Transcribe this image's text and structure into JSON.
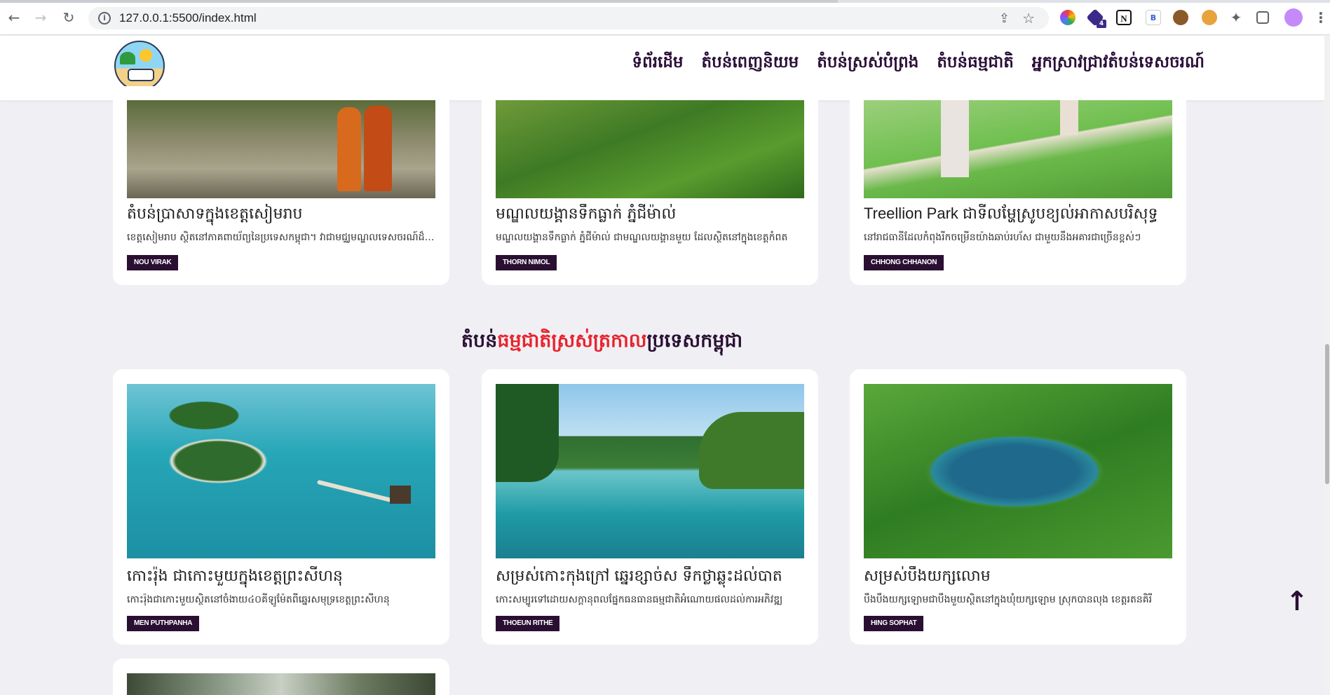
{
  "browser": {
    "url": "127.0.0.1:5500/index.html",
    "extensions": [
      "color-wheel-extension-icon",
      "vpn-extension-icon",
      "notion-extension-icon",
      "bold-extension-icon",
      "cookie-extension-icon",
      "cookie-alt-extension-icon",
      "puzzle-extensions-icon",
      "sidebar-icon",
      "profile-avatar"
    ],
    "vpn_badge": "4"
  },
  "nav": {
    "items": [
      "ទំព័រដើម",
      "តំបន់ពេញនិយម",
      "តំបន់ស្រស់បំព្រង",
      "តំបន់ធម្មជាតិ",
      "អ្នកស្រាវជ្រាវតំបន់ទេសចរណ៍"
    ]
  },
  "section": {
    "title_pre": "តំបន់",
    "title_accent": "ធម្មជាតិស្រស់ត្រកាល",
    "title_post": "ប្រទេសកម្ពុជា"
  },
  "top_cards": [
    {
      "title": "តំបន់ប្រាសាទក្នុងខេត្តសៀមរាប",
      "desc": "ខេត្តសៀមរាប ស្ថិតនៅភាគពាយ័ព្យនៃប្រទេសកម្ពុជា។ វាជាមជ្ឈមណ្ឌលទេសចរណ៍ដ៏សំខាន់",
      "author": "NOU VIRAK"
    },
    {
      "title": "មណ្ឌលយង្គានទឹកធ្លាក់ ភ្នំជីម៉ាល់",
      "desc": "មណ្ឌលយង្គានទឹកធ្លាក់ ភ្នំជីម៉ាល់ ជាមណ្ឌលយង្គានមួយ ដែលស្ថិតនៅក្នុងខេត្តកំពត",
      "author": "THORN NIMOL"
    },
    {
      "title": "Treellion Park ជាទីលម្ហែស្រូបខ្យល់អាកាសបរិសុទ្ធ",
      "desc": "នៅរាជធានីដែលកំពុងរីកចម្រើនយ៉ាងឆាប់រហ័ស ជាមួយនឹងអគារជាច្រើនខ្ពស់ៗ",
      "author": "CHHONG CHHANON"
    }
  ],
  "nature_cards": [
    {
      "title": "កោះរ៉ុង ជាកោះមួយក្នុងខេត្តព្រះសីហនុ",
      "desc": "កោះរ៉ុងជាកោះមួយស្ថិតនៅចំងាយ៤០គីឡូម៉ែតពីឆ្នេរសមុទ្រខេត្តព្រះសីហនុ",
      "author": "MEN PUTHPANHA"
    },
    {
      "title": "សម្រស់កោះកុងក្រៅ ឆ្នេរខ្សាច់ស ទឹកថ្លាឆ្លុះដល់បាត",
      "desc": "កោះសម្បូរទៅដោយសក្តានុពលផ្នែកធនធានធម្មជាតិអំណោយផលដល់ការអភិវឌ្ឍ",
      "author": "THOEUN RITHE"
    },
    {
      "title": "សម្រស់បឹងយក្សលោម",
      "desc": "បឹងបឹងយក្សឡោមជាបឹងមួយស្ថិតនៅក្នុងឃុំយក្សឡោម ស្រុកបានលុង ខេត្តរតនគិរី",
      "author": "HING SOPHAT"
    }
  ]
}
